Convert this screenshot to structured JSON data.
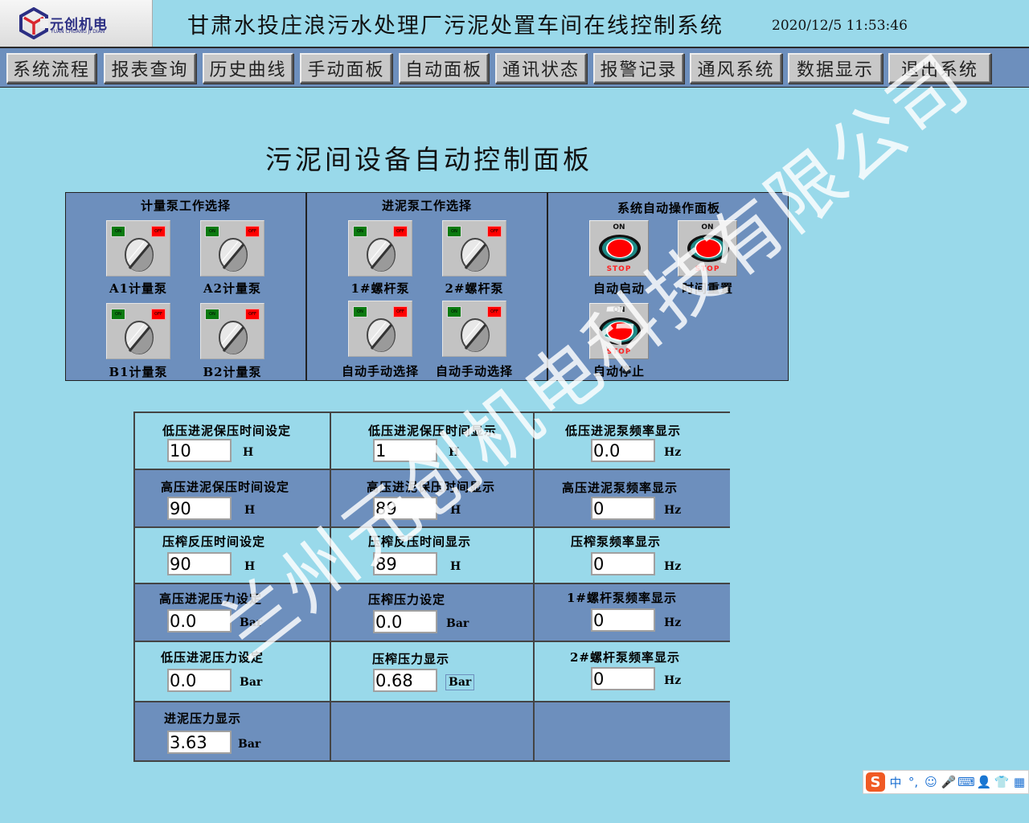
{
  "header": {
    "logo_cn": "元创机电",
    "logo_en": "YUAN CHUANG JI DIAN",
    "title": "甘肃水投庄浪污水处理厂污泥处置车间在线控制系统",
    "datetime": "2020/12/5 11:53:46"
  },
  "nav": {
    "items": [
      {
        "label": "系统流程"
      },
      {
        "label": "报表查询"
      },
      {
        "label": "历史曲线"
      },
      {
        "label": "手动面板"
      },
      {
        "label": "自动面板"
      },
      {
        "label": "通讯状态"
      },
      {
        "label": "报警记录"
      },
      {
        "label": "通风系统"
      },
      {
        "label": "数据显示"
      },
      {
        "label": "退出系统"
      }
    ]
  },
  "page_title": "污泥间设备自动控制面板",
  "panels": {
    "metering": {
      "title": "计量泵工作选择",
      "switches": [
        {
          "label": "A1计量泵",
          "on": "ON",
          "off": "OFF"
        },
        {
          "label": "A2计量泵",
          "on": "ON",
          "off": "OFF"
        },
        {
          "label": "B1计量泵",
          "on": "ON",
          "off": "OFF"
        },
        {
          "label": "B2计量泵",
          "on": "ON",
          "off": "OFF"
        }
      ]
    },
    "feed": {
      "title": "进泥泵工作选择",
      "switches": [
        {
          "label": "1#螺杆泵",
          "on": "ON",
          "off": "OFF"
        },
        {
          "label": "2#螺杆泵",
          "on": "ON",
          "off": "OFF"
        },
        {
          "label": "自动手动选择",
          "on": "ON",
          "off": "OFF"
        },
        {
          "label": "自动手动选择",
          "on": "ON",
          "off": "OFF"
        }
      ]
    },
    "auto": {
      "title": "系统自动操作面板",
      "buttons": [
        {
          "label": "自动启动",
          "on": "ON",
          "stop": "STOP"
        },
        {
          "label": "时间重置",
          "on": "ON",
          "stop": "STOP"
        },
        {
          "label": "自动停止",
          "on": "ON",
          "stop": "STOP"
        }
      ]
    }
  },
  "grid": {
    "rows": [
      [
        {
          "label": "低压进泥保压时间设定",
          "value": "10",
          "unit": "H"
        },
        {
          "label": "低压进泥保压时间显示",
          "value": "1",
          "unit": "H"
        },
        {
          "label": "低压进泥泵频率显示",
          "value": "0.0",
          "unit": "Hz"
        }
      ],
      [
        {
          "label": "高压进泥保压时间设定",
          "value": "90",
          "unit": "H"
        },
        {
          "label": "高压进泥保压时间显示",
          "value": "89",
          "unit": "H"
        },
        {
          "label": "高压进泥泵频率显示",
          "value": "0",
          "unit": "Hz"
        }
      ],
      [
        {
          "label": "压榨反压时间设定",
          "value": "90",
          "unit": "H"
        },
        {
          "label": "压榨反压时间显示",
          "value": "89",
          "unit": "H"
        },
        {
          "label": "压榨泵频率显示",
          "value": "0",
          "unit": "Hz"
        }
      ],
      [
        {
          "label": "高压进泥压力设定",
          "value": "0.0",
          "unit": "Bar"
        },
        {
          "label": "压榨压力设定",
          "value": "0.0",
          "unit": "Bar"
        },
        {
          "label": "1#螺杆泵频率显示",
          "value": "0",
          "unit": "Hz"
        }
      ],
      [
        {
          "label": "低压进泥压力设定",
          "value": "0.0",
          "unit": "Bar"
        },
        {
          "label": "压榨压力显示",
          "value": "0.68",
          "unit": "Bar"
        },
        {
          "label": "2#螺杆泵频率显示",
          "value": "0",
          "unit": "Hz"
        }
      ],
      [
        {
          "label": "进泥压力显示",
          "value": "3.63",
          "unit": "Bar"
        }
      ]
    ]
  },
  "watermark": "兰州元创机电科技有限公司",
  "ime": {
    "logo": "S",
    "items": [
      "中",
      "°,",
      "☺",
      "🎤",
      "⌨",
      "👤",
      "👕",
      "▦"
    ]
  },
  "colors": {
    "background": "#99d9ea",
    "panel": "#6d8fbd",
    "on_led": "#0b7a10",
    "off_led": "#ff0000",
    "stop_red": "#ff2020"
  }
}
